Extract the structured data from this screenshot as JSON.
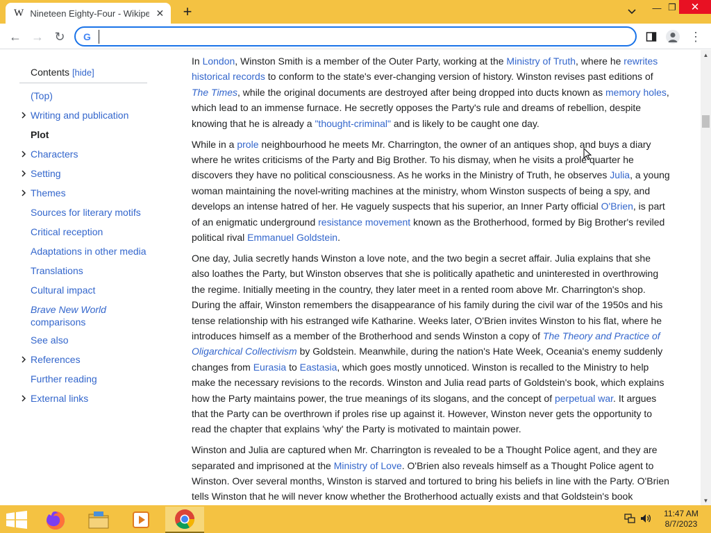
{
  "browser": {
    "tab": {
      "favicon": "W",
      "title": "Nineteen Eighty-Four - Wikipedia",
      "close_glyph": "✕"
    },
    "new_tab_glyph": "+",
    "window": {
      "minimize": "—",
      "maximize": "❐",
      "close": "✕"
    },
    "toolbar": {
      "back": "←",
      "forward": "→",
      "reload": "↻",
      "menu": "⋮"
    },
    "omnibox": {
      "icon": "G",
      "value": "",
      "placeholder": ""
    },
    "accent": "#1a73e8",
    "frame_color": "#f4c242"
  },
  "toc": {
    "title": "Contents",
    "hide_label": "[hide]",
    "items": [
      {
        "label": "(Top)",
        "expandable": false,
        "active": false
      },
      {
        "label": "Writing and publication",
        "expandable": true,
        "active": false
      },
      {
        "label": "Plot",
        "expandable": false,
        "active": true
      },
      {
        "label": "Characters",
        "expandable": true,
        "active": false
      },
      {
        "label": "Setting",
        "expandable": true,
        "active": false
      },
      {
        "label": "Themes",
        "expandable": true,
        "active": false
      },
      {
        "label": "Sources for literary motifs",
        "expandable": false,
        "active": false
      },
      {
        "label": "Critical reception",
        "expandable": false,
        "active": false
      },
      {
        "label": "Adaptations in other media",
        "expandable": false,
        "active": false
      },
      {
        "label": "Translations",
        "expandable": false,
        "active": false
      },
      {
        "label": "Cultural impact",
        "expandable": false,
        "active": false
      },
      {
        "label_italic": "Brave New World",
        "label_rest": " comparisons",
        "expandable": false,
        "active": false
      },
      {
        "label": "See also",
        "expandable": false,
        "active": false
      },
      {
        "label": "References",
        "expandable": true,
        "active": false
      },
      {
        "label": "Further reading",
        "expandable": false,
        "active": false
      },
      {
        "label": "External links",
        "expandable": true,
        "active": false
      }
    ]
  },
  "article": {
    "p1": {
      "s1": "In ",
      "l1": "London",
      "s2": ", Winston Smith is a member of the Outer Party, working at the ",
      "l2": "Ministry of Truth",
      "s3": ", where he ",
      "l3": "rewrites historical records",
      "s4": " to conform to the state's ever-changing version of history. Winston revises past editions of ",
      "l4": "The Times",
      "s5": ", while the original documents are destroyed after being dropped into ducts known as ",
      "l5": "memory holes",
      "s6": ", which lead to an immense furnace. He secretly opposes the Party's rule and dreams of rebellion, despite knowing that he is already a ",
      "l6": "\"thought-criminal\"",
      "s7": " and is likely to be caught one day."
    },
    "p2": {
      "s1": "While in a ",
      "l1": "prole",
      "s2": " neighbourhood he meets Mr. Charrington, the owner of an antiques shop, and buys a diary where he writes criticisms of the Party and Big Brother. To his dismay, when he visits a prole quarter he discovers they have no political consciousness. As he works in the Ministry of Truth, he observes ",
      "l2": "Julia",
      "s3": ", a young woman maintaining the novel-writing machines at the ministry, whom Winston suspects of being a spy, and develops an intense hatred of her. He vaguely suspects that his superior, an Inner Party official ",
      "l3": "O'Brien",
      "s4": ", is part of an enigmatic underground ",
      "l4": "resistance movement",
      "s5": " known as the Brotherhood, formed by Big Brother's reviled political rival ",
      "l5": "Emmanuel Goldstein",
      "s6": "."
    },
    "p3": {
      "s1": "One day, Julia secretly hands Winston a love note, and the two begin a secret affair. Julia explains that she also loathes the Party, but Winston observes that she is politically apathetic and uninterested in overthrowing the regime. Initially meeting in the country, they later meet in a rented room above Mr. Charrington's shop. During the affair, Winston remembers the disappearance of his family during the civil war of the 1950s and his tense relationship with his estranged wife Katharine. Weeks later, O'Brien invites Winston to his flat, where he introduces himself as a member of the Brotherhood and sends Winston a copy of ",
      "l1": "The Theory and Practice of Oligarchical Collectivism",
      "s2": " by Goldstein. Meanwhile, during the nation's Hate Week, Oceania's enemy suddenly changes from ",
      "l2": "Eurasia",
      "s3": " to ",
      "l3": "Eastasia",
      "s4": ", which goes mostly unnoticed. Winston is recalled to the Ministry to help make the necessary revisions to the records. Winston and Julia read parts of Goldstein's book, which explains how the Party maintains power, the true meanings of its slogans, and the concept of ",
      "l4": "perpetual war",
      "s5": ". It argues that the Party can be overthrown if proles rise up against it. However, Winston never gets the opportunity to read the chapter that explains 'why' the Party is motivated to maintain power."
    },
    "p4": {
      "s1": "Winston and Julia are captured when Mr. Charrington is revealed to be a Thought Police agent, and they are separated and imprisoned at the ",
      "l1": "Ministry of Love",
      "s2": ". O'Brien also reveals himself as a Thought Police agent to Winston. Over several months, Winston is starved and tortured to bring his beliefs in line with the Party. O'Brien tells Winston that he will never know whether the Brotherhood actually exists and that Goldstein's book"
    }
  },
  "taskbar": {
    "apps": [
      "windows-start",
      "firefox",
      "file-explorer",
      "media-player",
      "chrome"
    ],
    "time": "11:47 AM",
    "date": "8/7/2023"
  }
}
